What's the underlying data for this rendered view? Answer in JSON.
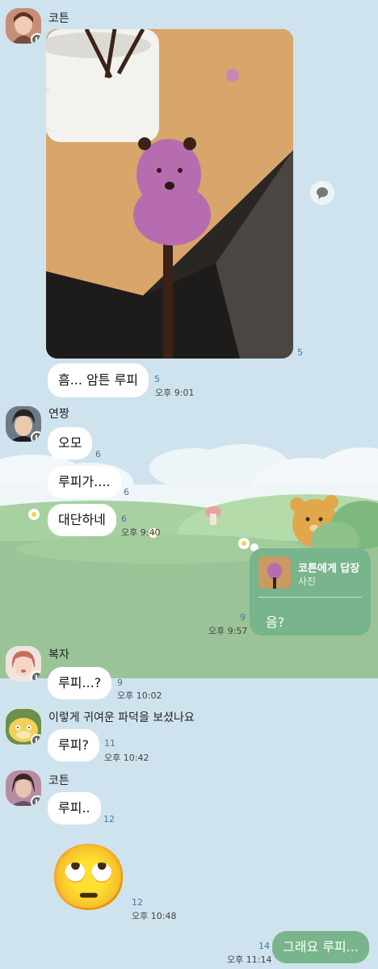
{
  "messages": {
    "m1": {
      "sender": "코튼",
      "read_count": "5",
      "time": ""
    },
    "m2": {
      "text": "흠... 암튼 루피",
      "read_count": "5",
      "time": "오후 9:01"
    },
    "m3": {
      "sender": "연짱",
      "text": "오모",
      "read_count": "6"
    },
    "m4": {
      "text": "루피가....",
      "read_count": "6"
    },
    "m5": {
      "text": "대단하네",
      "read_count": "6",
      "time": "오후 9:40"
    },
    "m6": {
      "reply_title": "코튼에게 답장",
      "reply_sub": "사진",
      "text": "음?",
      "read_count": "9",
      "time": "오후 9:57"
    },
    "m7": {
      "sender": "복자",
      "text": "루피...?",
      "read_count": "9",
      "time": "오후 10:02"
    },
    "m8": {
      "sender": "이렇게 귀여운 파덕을 보셨나요",
      "text": "루피?",
      "read_count": "11",
      "time": "오후 10:42"
    },
    "m9": {
      "sender": "코튼",
      "text": "루피..",
      "read_count": "12"
    },
    "m10": {
      "emoji": "🙄",
      "read_count": "12",
      "time": "오후 10:48"
    },
    "m11": {
      "text": "그래요 루피...",
      "read_count": "14",
      "time": "오후 11:14"
    }
  },
  "colors": {
    "background": "#cfe3ee",
    "my_bubble": "#78b48c",
    "read_count": "#4b73a8"
  },
  "icons": {
    "share": "speech-bubble-icon",
    "badge": "profile-badge-icon"
  }
}
